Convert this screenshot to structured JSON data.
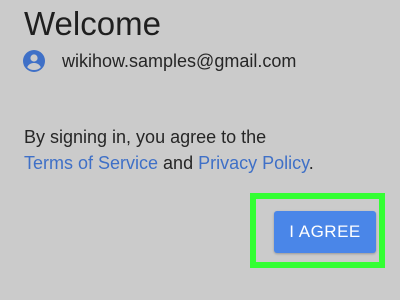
{
  "header": {
    "title": "Welcome"
  },
  "account": {
    "icon": "account-circle-icon",
    "email": "wikihow.samples@gmail.com"
  },
  "consent": {
    "line1": "By signing in, you agree to the",
    "terms_link": "Terms of Service",
    "conjunction": " and ",
    "privacy_link": "Privacy Policy",
    "period": "."
  },
  "actions": {
    "agree_label": "I AGREE"
  },
  "colors": {
    "background": "#cbcbcb",
    "link": "#3f70c7",
    "button": "#4a86e8",
    "highlight": "#33ff33"
  }
}
